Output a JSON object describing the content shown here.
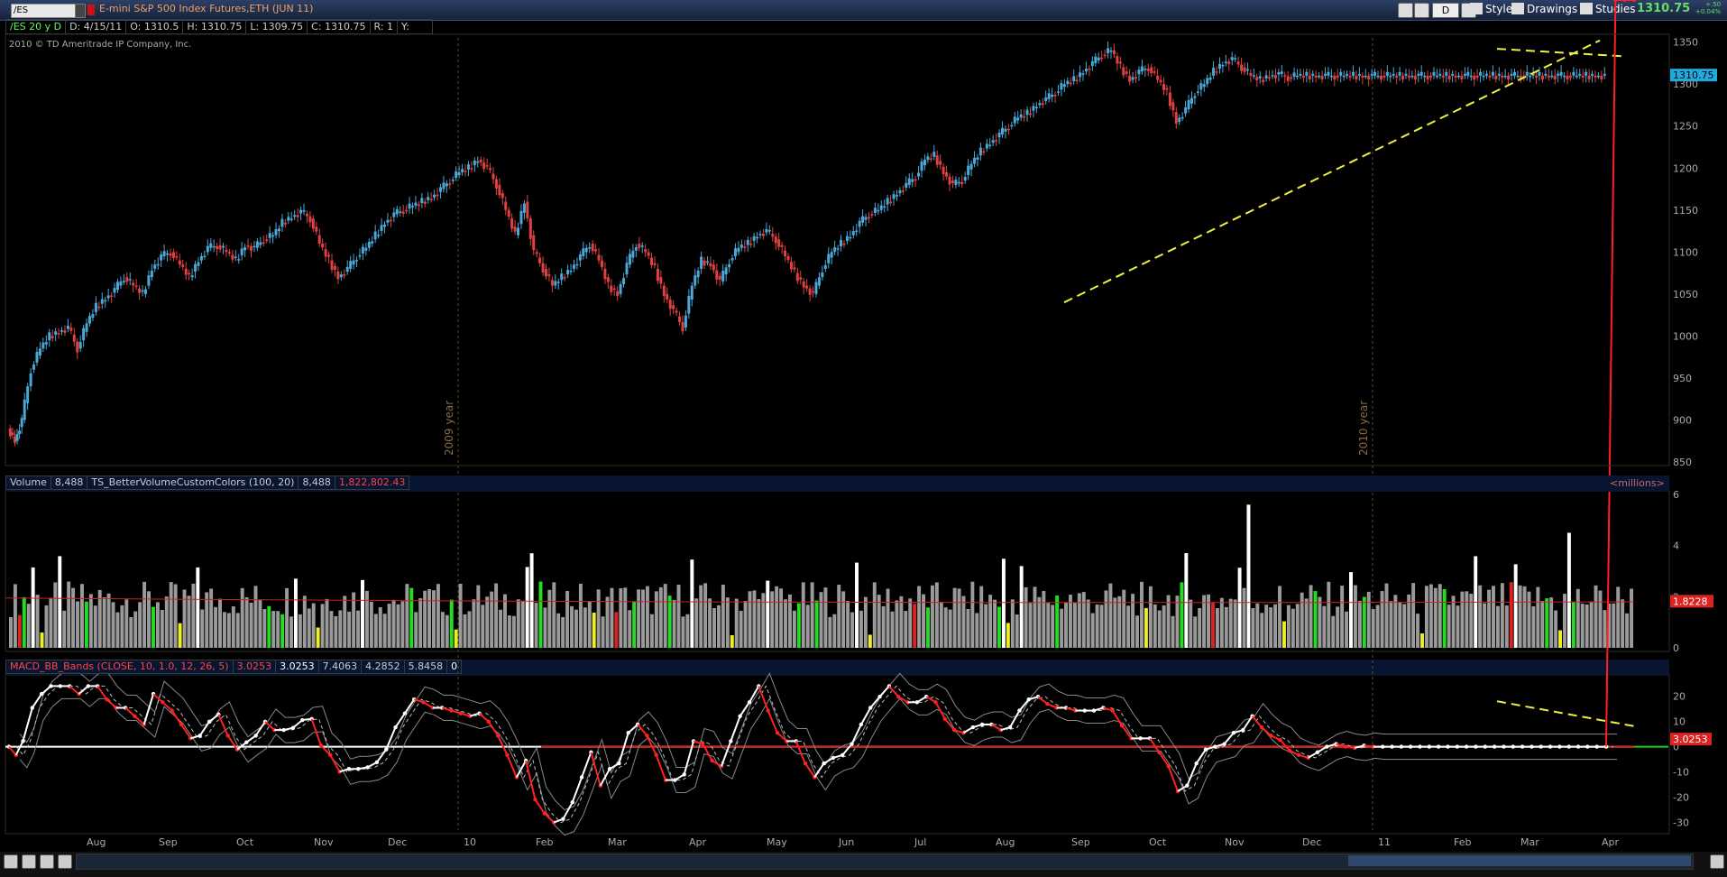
{
  "toolbar": {
    "symbol": "/ES",
    "description": "E-mini S&P 500 Index Futures,ETH (JUN 11)",
    "period_button": "D",
    "style_label": "Style",
    "drawings_label": "Drawings",
    "studies_label": "Studies",
    "last_price": "1310.75",
    "change_abs": "+.50",
    "change_pct": "+0.04%"
  },
  "info": {
    "chart_label": "/ES 20 y D",
    "date": "D: 4/15/11",
    "open": "O: 1310.5",
    "high": "H: 1310.75",
    "low": "L: 1309.75",
    "close": "C: 1310.75",
    "r": "R: 1",
    "y": "Y:"
  },
  "copyright": "2010 © TD Ameritrade IP Company, Inc.",
  "volume_bar": {
    "label": "Volume",
    "value": "8,488",
    "study": "TS_BetterVolumeCustomColors (100, 20)",
    "value2": "8,488",
    "value3": "1,822,802.43",
    "units": "<millions>"
  },
  "macd_bar": {
    "study": "MACD_BB_Bands (CLOSE, 10, 1.0, 12, 26, 5)",
    "v1": "3.0253",
    "v2": "3.0253",
    "v3": "7.4063",
    "v4": "4.2852",
    "v5": "5.8458",
    "v6": "0"
  },
  "chart_data": {
    "type": "line",
    "price_axis": {
      "ticks": [
        "1350",
        "1300",
        "1250",
        "1200",
        "1150",
        "1100",
        "1050",
        "1000",
        "950",
        "900",
        "850"
      ],
      "ylim": [
        850,
        1355
      ]
    },
    "price_label": "1310.75",
    "year_markers": [
      "2009 year",
      "2010 year"
    ],
    "price_series": {
      "x": [
        0,
        3,
        6,
        10,
        14,
        18,
        22,
        26,
        30,
        34,
        38,
        42,
        46,
        50,
        54,
        58,
        62,
        66,
        70,
        74,
        78,
        82,
        86,
        90,
        94,
        98,
        102,
        106,
        110,
        114,
        118,
        122,
        126,
        130,
        134,
        138,
        142,
        146,
        150,
        154,
        158,
        162,
        166,
        170,
        174,
        178,
        182,
        186,
        190,
        194,
        198,
        202,
        206,
        210,
        214,
        218,
        222,
        226,
        230,
        234,
        238,
        242,
        246,
        250,
        254,
        258,
        262,
        266,
        270,
        274,
        278,
        282,
        286,
        290,
        294,
        298,
        302,
        306,
        310,
        314,
        318,
        322,
        326,
        330,
        334,
        338,
        342,
        346,
        350,
        354,
        358,
        362,
        366,
        370,
        374,
        378,
        382,
        386,
        390,
        394,
        398,
        402,
        406,
        410,
        414,
        418,
        422,
        426,
        430,
        434,
        438,
        442,
        446,
        450,
        454,
        458,
        462,
        466,
        470,
        474,
        478,
        482,
        486,
        490,
        494,
        498,
        502,
        506,
        510,
        514,
        518,
        522,
        526,
        530,
        534,
        538,
        542,
        546,
        550,
        554,
        558,
        562,
        566,
        570,
        574,
        578,
        582,
        586,
        590,
        594,
        598,
        602,
        606,
        610,
        614,
        618,
        622,
        626,
        630,
        634,
        638,
        642,
        646,
        650,
        654,
        658,
        662,
        666,
        670,
        674,
        678,
        682,
        686,
        690,
        694,
        698
      ],
      "y": [
        890,
        875,
        900,
        960,
        985,
        1000,
        1005,
        1010,
        985,
        1015,
        1035,
        1045,
        1055,
        1070,
        1060,
        1050,
        1080,
        1095,
        1100,
        1085,
        1070,
        1090,
        1105,
        1108,
        1100,
        1090,
        1108,
        1105,
        1115,
        1120,
        1135,
        1142,
        1148,
        1140,
        1110,
        1090,
        1070,
        1080,
        1095,
        1105,
        1120,
        1135,
        1145,
        1150,
        1155,
        1160,
        1165,
        1175,
        1185,
        1195,
        1200,
        1210,
        1200,
        1180,
        1150,
        1120,
        1160,
        1100,
        1080,
        1060,
        1070,
        1080,
        1095,
        1110,
        1090,
        1060,
        1050,
        1085,
        1110,
        1100,
        1080,
        1050,
        1030,
        1010,
        1060,
        1090,
        1085,
        1065,
        1090,
        1105,
        1110,
        1120,
        1125,
        1115,
        1095,
        1075,
        1060,
        1050,
        1080,
        1100,
        1110,
        1120,
        1135,
        1145,
        1150,
        1160,
        1170,
        1180,
        1190,
        1210,
        1215,
        1195,
        1180,
        1185,
        1205,
        1220,
        1230,
        1240,
        1250,
        1260,
        1265,
        1275,
        1282,
        1290,
        1300,
        1305,
        1315,
        1325,
        1335,
        1340,
        1320,
        1305,
        1315,
        1320,
        1305,
        1290,
        1255,
        1270,
        1290,
        1300,
        1315,
        1325,
        1330,
        1320,
        1310,
        1305,
        1310,
        1312,
        1308,
        1310,
        1310,
        1310,
        1310,
        1310,
        1310,
        1310,
        1310,
        1310,
        1310,
        1310,
        1310,
        1310,
        1310,
        1310,
        1310,
        1310,
        1310,
        1310,
        1310,
        1310,
        1310,
        1310,
        1310,
        1310,
        1310,
        1310,
        1310,
        1310,
        1310,
        1310,
        1310,
        1310,
        1310
      ]
    },
    "trendlines": [
      {
        "from": [
          1180,
          1040
        ],
        "to": [
          1774,
          1352
        ]
      },
      {
        "from": [
          1660,
          1342
        ],
        "to": [
          1802,
          1333
        ]
      }
    ],
    "volume_axis": {
      "ticks": [
        "6",
        "4",
        "2",
        "0"
      ],
      "ylim": [
        0,
        6
      ],
      "avg_label": "1.8228"
    },
    "macd_axis": {
      "ticks": [
        "20",
        "10",
        "0",
        "-10",
        "-20",
        "-30"
      ],
      "ylim": [
        -33,
        27
      ],
      "value_label": "3.0253"
    },
    "x_labels": [
      "Aug",
      "Sep",
      "Oct",
      "Nov",
      "Dec",
      "10",
      "Feb",
      "Mar",
      "Apr",
      "May",
      "Jun",
      "Jul",
      "Aug",
      "Sep",
      "Oct",
      "Nov",
      "Dec",
      "11",
      "Feb",
      "Mar",
      "Apr"
    ],
    "colors": {
      "up": "#4aa8d8",
      "down": "#e04040",
      "trend": "#f0f040",
      "macd_dot": "#ffffff",
      "macd_red": "#ff2020",
      "bar_gray": "#9a9a9a",
      "bar_green": "#22dd22",
      "bar_yellow": "#eeee22",
      "bar_red": "#dd2222",
      "bar_white": "#ffffff"
    }
  }
}
